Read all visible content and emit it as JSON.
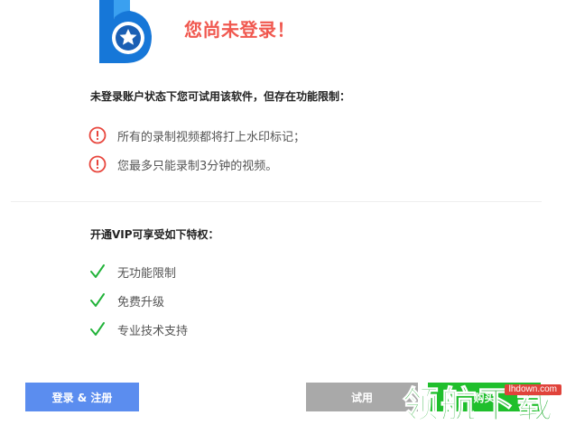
{
  "header": {
    "title": "您尚未登录！",
    "title_color": "#f0584f",
    "logo_icon": "app-logo-star-icon"
  },
  "limitations": {
    "heading": "未登录账户状态下您可试用该软件，但存在功能限制：",
    "icon": "exclamation-circle-icon",
    "icon_color": "#e8453c",
    "items": [
      {
        "label": "所有的录制视频都将打上水印标记；"
      },
      {
        "label": "您最多只能录制3分钟的视频。"
      }
    ]
  },
  "vip": {
    "heading": "开通VIP可享受如下特权：",
    "icon": "checkmark-icon",
    "icon_color": "#22b33a",
    "items": [
      {
        "label": "无功能限制"
      },
      {
        "label": "免费升级"
      },
      {
        "label": "专业技术支持"
      }
    ]
  },
  "actions": {
    "login_label": "登录 & 注册",
    "trial_label": "试用",
    "buy_label": "购买"
  },
  "watermark": {
    "text": "领航下载",
    "url": "lhdown.com"
  }
}
